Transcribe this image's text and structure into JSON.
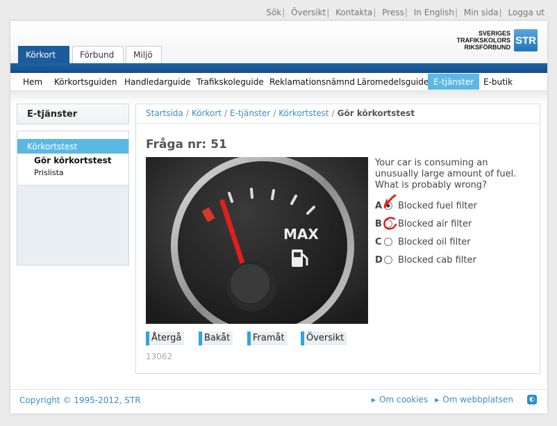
{
  "top_links": [
    "Sök",
    "Översikt",
    "Kontakta",
    "Press",
    "In English",
    "Min sida",
    "Logga ut"
  ],
  "tabs": [
    {
      "label": "Körkort",
      "active": true
    },
    {
      "label": "Förbund",
      "active": false
    },
    {
      "label": "Miljö",
      "active": false
    }
  ],
  "logo": {
    "line1": "SVERIGES",
    "line2": "TRAFIKSKOLORS",
    "line3": "RIKSFÖRBUND",
    "badge": "STR"
  },
  "main_nav": [
    {
      "label": "Hem",
      "active": false
    },
    {
      "label": "Körkortsguiden",
      "active": false
    },
    {
      "label": "Handledarguide",
      "active": false
    },
    {
      "label": "Trafikskoleguide",
      "active": false
    },
    {
      "label": "Reklamationsnämnd",
      "active": false
    },
    {
      "label": "Läromedelsguide",
      "active": false
    },
    {
      "label": "E-tjänster",
      "active": true
    },
    {
      "label": "E-butik",
      "active": false
    }
  ],
  "sidebar": {
    "title": "E-tjänster",
    "items": [
      "Körkortstest",
      "Gör körkortstest",
      "Prislista"
    ]
  },
  "breadcrumb": {
    "links": [
      "Startsida",
      "Körkort",
      "E-tjänster",
      "Körkortstest"
    ],
    "current": "Gör körkortstest"
  },
  "question": {
    "title": "Fråga nr: 51",
    "text": "Your car is consuming an unusually large amount of fuel. What is probably wrong?",
    "gauge_label": "MAX",
    "answers": [
      {
        "letter": "A",
        "text": "Blocked fuel filter",
        "selected": true
      },
      {
        "letter": "B",
        "text": "Blocked air filter",
        "selected": false
      },
      {
        "letter": "C",
        "text": "Blocked oil filter",
        "selected": false
      },
      {
        "letter": "D",
        "text": "Blocked cab filter",
        "selected": false
      }
    ],
    "marks": {
      "wrong_color": "#e0201c"
    },
    "buttons": {
      "back": "Återgå",
      "prev": "Bakåt",
      "next": "Framåt",
      "overview": "Översikt"
    },
    "id": "13062"
  },
  "footer": {
    "copyright": "Copyright © 1995-2012, STR",
    "links": [
      "Om cookies",
      "Om webbplatsen"
    ]
  },
  "colors": {
    "nav_blue": "#1c5c9c",
    "active_cyan": "#5bb7e4",
    "link_blue": "#3a8fc4"
  }
}
